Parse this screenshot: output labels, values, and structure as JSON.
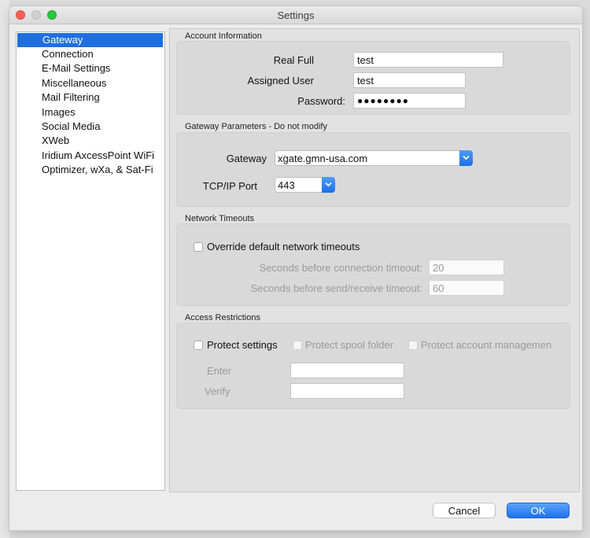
{
  "window": {
    "title": "Settings"
  },
  "sidebar": {
    "items": [
      {
        "label": "Gateway"
      },
      {
        "label": "Connection"
      },
      {
        "label": "E-Mail Settings"
      },
      {
        "label": "Miscellaneous"
      },
      {
        "label": "Mail Filtering"
      },
      {
        "label": "Images"
      },
      {
        "label": "Social Media"
      },
      {
        "label": "XWeb"
      },
      {
        "label": "Iridium AxcessPoint WiFi"
      },
      {
        "label": "Optimizer, wXa, & Sat-Fi"
      }
    ],
    "selected": "Gateway"
  },
  "account": {
    "section_label": "Account Information",
    "real_full_label": "Real Full",
    "real_full_value": "test",
    "assigned_user_label": "Assigned User",
    "assigned_user_value": "test",
    "password_label": "Password:",
    "password_value": "●●●●●●●●"
  },
  "gateway_params": {
    "section_label": "Gateway Parameters - Do not modify",
    "gateway_label": "Gateway",
    "gateway_value": "xgate.gmn-usa.com",
    "port_label": "TCP/IP Port",
    "port_value": "443"
  },
  "timeouts": {
    "section_label": "Network Timeouts",
    "override_label": "Override default network timeouts",
    "override_checked": false,
    "connection_label": "Seconds before connection timeout:",
    "connection_value": "20",
    "send_receive_label": "Seconds before send/receive timeout:",
    "send_receive_value": "60"
  },
  "access": {
    "section_label": "Access Restrictions",
    "protect_settings_label": "Protect settings",
    "protect_spool_label": "Protect spool folder",
    "protect_account_label": "Protect account managemen",
    "enter_label": "Enter",
    "enter_value": "",
    "verify_label": "Verify",
    "verify_value": ""
  },
  "footer": {
    "cancel_label": "Cancel",
    "ok_label": "OK"
  },
  "colors": {
    "selection": "#1f6fde",
    "accent_button": "#1f72ea",
    "close": "#fe5f57",
    "zoom": "#28c840"
  },
  "icons": [
    "close-icon",
    "minimize-icon",
    "zoom-icon",
    "chevron-down-icon"
  ]
}
